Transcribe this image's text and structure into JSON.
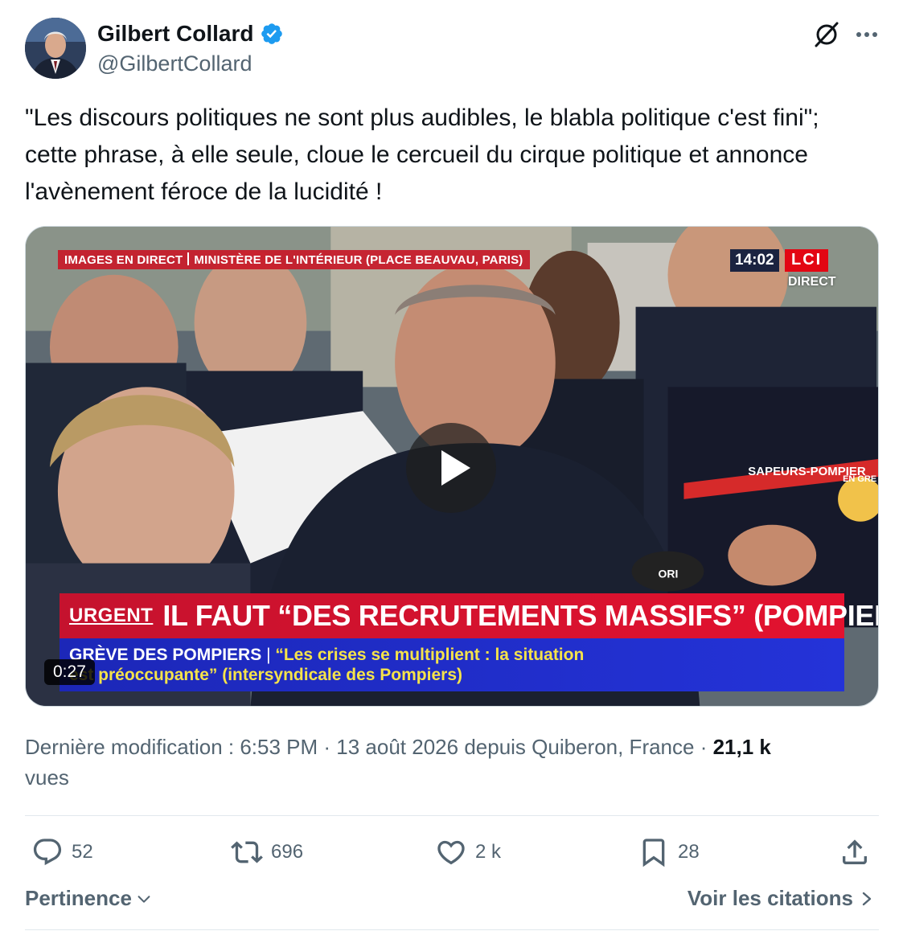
{
  "author": {
    "display_name": "Gilbert Collard",
    "handle": "@GilbertCollard",
    "verified": true,
    "badge_color": "#1d9bf0"
  },
  "tweet": {
    "text": "\"Les discours politiques ne sont plus audibles, le blabla politique c'est fini\"; cette phrase, à elle seule, cloue le cercueil du cirque politique et annonce l'avènement féroce de la lucidité !"
  },
  "video": {
    "duration": "0:27",
    "live_label": "IMAGES EN DIRECT",
    "location_label": "MINISTÈRE DE L'INTÉRIEUR (PLACE BEAUVAU, PARIS)",
    "clock": "14:02",
    "channel": "LCI",
    "direct_label": "DIRECT",
    "urgent_tag": "URGENT",
    "headline": "IL FAUT “DES RECRUTEMENTS MASSIFS” (POMPIERS)",
    "sub_topic": "GRÈVE DES POMPIERS",
    "sub_quote_line1": "“Les crises se multiplient : la situation",
    "sub_quote_line2": "est préoccupante” (intersyndicale des Pompiers)",
    "jacket_text": "SAPEURS-POMPIER",
    "badge_text": "EN GRE",
    "mic_text": "ORI"
  },
  "meta": {
    "prefix": "Dernière modification : ",
    "time": "6:53 PM",
    "dot": " · ",
    "date_place": "13 août 2026 depuis Quiberon, France",
    "views_count": "21,1 k",
    "views_label": "vues"
  },
  "actions": {
    "replies": "52",
    "reposts": "696",
    "likes": "2 k",
    "bookmarks": "28"
  },
  "footer": {
    "sort_label": "Pertinence",
    "quotes_label": "Voir les citations"
  },
  "colors": {
    "text_primary": "#0f1419",
    "text_secondary": "#536471",
    "urgent_red": "#d4122f",
    "sub_blue": "#1f2cc8"
  }
}
